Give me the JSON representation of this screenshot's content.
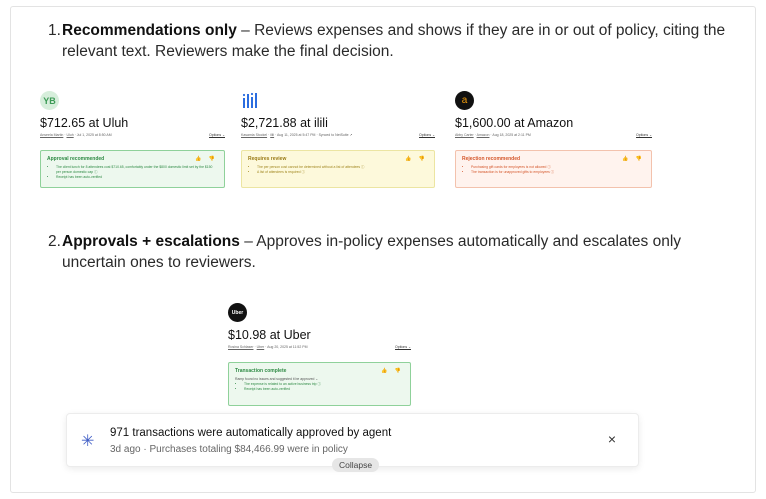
{
  "points": [
    {
      "number": "1.",
      "title": "Recommendations only",
      "text": " – Reviews expenses and shows if they are in or out of policy, citing the relevant text. Reviewers make the final decision."
    },
    {
      "number": "2.",
      "title": "Approvals + escalations",
      "text": " – Approves in-policy expenses automatically and escalates only uncertain ones to reviewers."
    }
  ],
  "cards": [
    {
      "logo_text": "YB",
      "amount": "$712.65 at Uluh",
      "meta_person": "Anseela Martin",
      "meta_vendor": "Uluh",
      "meta_date": " · Jul 1, 2025 at 8:50 AM",
      "options": "Options ⌄",
      "box_title": "Approval recommended",
      "thumbs": "👍 👎",
      "bullets": [
        "The client lunch for 8 attendees cost $710.65, comfortably under the $800 domestic limit set by the $150 per person domestic cap ⓘ",
        "Receipt has been auto-verified"
      ]
    },
    {
      "logo_text": "",
      "amount": "$2,721.88 at ilili",
      "meta_person": "Kasamia Stockel",
      "meta_vendor": "ilili",
      "meta_date": " · Aug 11, 2025 at 5:47 PM · Synced to NetSuite ↗",
      "options": "Options ⌄",
      "box_title": "Requires review",
      "thumbs": "👍 👎",
      "bullets": [
        "The per person cost cannot be determined without a list of attendees ⓘ",
        "A list of attendees is required ⓘ"
      ]
    },
    {
      "logo_text": "a",
      "amount": "$1,600.00 at Amazon",
      "meta_person": "Abby Carter",
      "meta_vendor": "Amazon",
      "meta_date": " · Aug 18, 2025 at 2:11 PM",
      "options": "Options ⌄",
      "box_title": "Rejection recommended",
      "thumbs": "👍 👎",
      "bullets": [
        "Purchasing gift cards for employees is not allowed ⓘ",
        "The transaction is for unapproved gifts to employees ⓘ"
      ]
    },
    {
      "logo_text": "Uber",
      "amount": "$10.98 at Uber",
      "meta_person": "Rosina Schlaser",
      "meta_vendor": "Uber",
      "meta_date": " · Aug 20, 2025 at 11:52 PM",
      "options": "Options ⌄",
      "box_title": "Transaction complete",
      "thumbs": "👍 👎",
      "lead": "Ramp found no issues and suggested it be approved ⌄",
      "bullets": [
        "The expense is related to an active business trip ⓘ",
        "Receipt has been auto-verified"
      ]
    }
  ],
  "toast": {
    "icon": "asterisk-icon",
    "title": "971 transactions were automatically approved by agent",
    "subtitle": "3d ago · Purchases totaling $84,466.99 were in policy",
    "close": "×"
  },
  "collapse_label": "Collapse",
  "colors": {
    "approve": "#2e8a44",
    "review": "#9a7b16",
    "reject": "#d4562a",
    "accent": "#3e5cc5"
  }
}
